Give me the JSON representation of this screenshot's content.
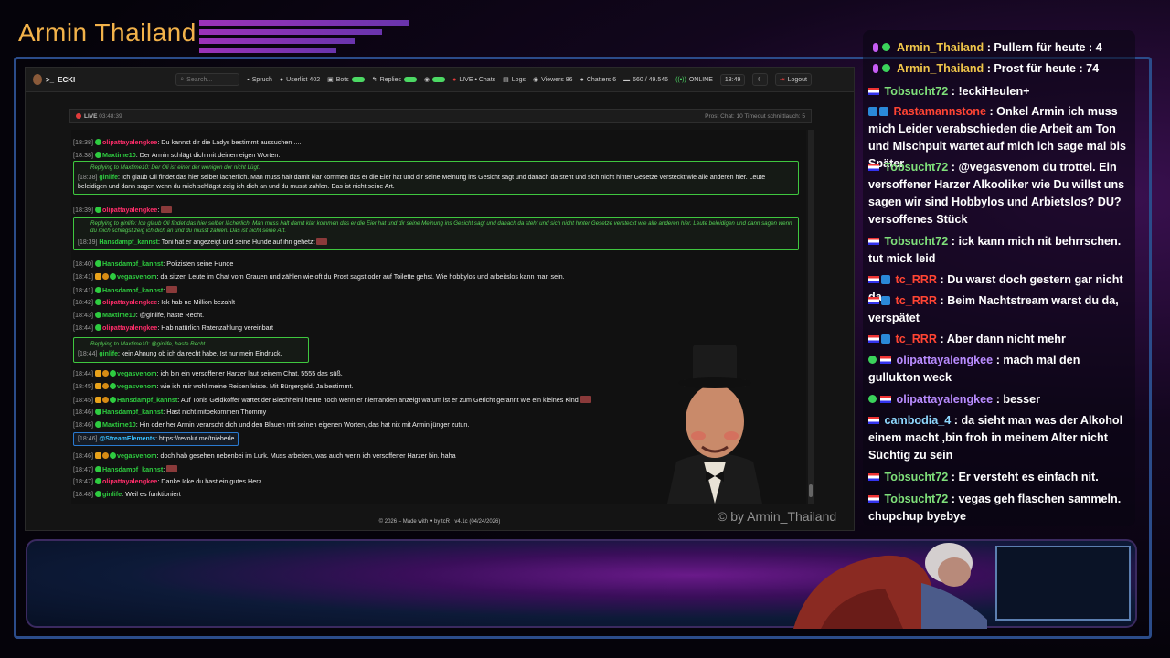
{
  "overlay": {
    "brand_title": "Armin Thailand",
    "watermark": "© by Armin_Thailand"
  },
  "app": {
    "title": "ECKI",
    "search_placeholder": "Search...",
    "toolbar": [
      {
        "icon": "quote-icon",
        "label": "Spruch"
      },
      {
        "icon": "user-icon",
        "label": "Userlist 402"
      },
      {
        "icon": "robot-icon",
        "label": "Bots"
      },
      {
        "icon": "reply-icon",
        "label": "Replies"
      },
      {
        "icon": "eye-icon",
        "label": ""
      },
      {
        "icon": "live-icon",
        "label": "LIVE • Chats"
      },
      {
        "icon": "logs-icon",
        "label": "Logs"
      },
      {
        "icon": "viewers-icon",
        "label": "Viewers 86"
      },
      {
        "icon": "chatters-icon",
        "label": "Chatters 6"
      },
      {
        "icon": "message-icon",
        "label": "660 / 49.546"
      },
      {
        "icon": "online-icon",
        "label": "ONLINE"
      },
      {
        "icon": "clock-icon",
        "label": "18:49"
      },
      {
        "icon": "moon-icon",
        "label": ""
      },
      {
        "icon": "logout-icon",
        "label": "Logout"
      }
    ],
    "live_status": "LIVE",
    "live_time": "03:48:39",
    "live_stats": "Prost Chat: 10   Timeout schnittlauch: 5",
    "footer": "© 2026 – Made with ♥ by tcR · v4.1c (04/24/2026)"
  },
  "chat": [
    {
      "ts": "[18:38]",
      "user": "olipattayalengkee",
      "color": "pink",
      "text": ": Du kannst dir die Ladys bestimmt aussuchen ...."
    },
    {
      "ts": "[18:38]",
      "user": "Maxtime10",
      "color": "green",
      "text": ": Der Armin schlägt dich mit deinen eigen Worten."
    },
    {
      "ts": "[18:39]",
      "user": "olipattayalengkee",
      "color": "pink",
      "text": ":"
    },
    {
      "ts": "[18:40]",
      "user": "Hansdampf_kannst",
      "color": "green",
      "text": ": Polizisten seine Hunde"
    },
    {
      "ts": "[18:41]",
      "user": "vegasvenom",
      "color": "green",
      "text": ": da sitzen Leute im Chat vom Grauen und zählen wie oft du Prost sagst oder auf Toilette gehst. Wie hobbylos und arbeitslos kann man sein."
    },
    {
      "ts": "[18:41]",
      "user": "Hansdampf_kannst",
      "color": "green",
      "text": ":"
    },
    {
      "ts": "[18:42]",
      "user": "olipattayalengkee",
      "color": "pink",
      "text": ": Ick hab ne Million bezahlt"
    },
    {
      "ts": "[18:43]",
      "user": "Maxtime10",
      "color": "green",
      "text": ": @ginlife, haste Recht."
    },
    {
      "ts": "[18:44]",
      "user": "olipattayalengkee",
      "color": "pink",
      "text": ": Hab natürlich Ratenzahlung vereinbart"
    },
    {
      "ts": "[18:44]",
      "user": "vegasvenom",
      "color": "green",
      "text": ": ich bin ein versoffener Harzer laut seinem Chat. 5555 das süß."
    },
    {
      "ts": "[18:45]",
      "user": "vegasvenom",
      "color": "green",
      "text": ": wie ich mir wohl meine Reisen leiste. Mit Bürgergeld. Ja bestimmt."
    },
    {
      "ts": "[18:45]",
      "user": "Hansdampf_kannst",
      "color": "green",
      "text": ": Auf Tonis Geldkoffer wartet der Blechheini heute noch wenn er niemanden anzeigt warum ist er zum Gericht gerannt wie ein kleines Kind"
    },
    {
      "ts": "[18:46]",
      "user": "Hansdampf_kannst",
      "color": "green",
      "text": ": Hast nicht mitbekommen Thommy"
    },
    {
      "ts": "[18:46]",
      "user": "Maxtime10",
      "color": "green",
      "text": ": Hin oder her Armin verarscht dich und den Blauen mit seinen eigenen Worten, das hat nix mit Armin jünger zutun."
    },
    {
      "ts": "[18:46]",
      "user": "vegasvenom",
      "color": "green",
      "text": ": doch hab gesehen nebenbei im Lurk. Muss arbeiten, was auch wenn ich versoffener Harzer bin. haha"
    },
    {
      "ts": "[18:47]",
      "user": "Hansdampf_kannst",
      "color": "green",
      "text": ":"
    },
    {
      "ts": "[18:47]",
      "user": "olipattayalengkee",
      "color": "pink",
      "text": ": Danke Icke du hast ein gutes Herz"
    },
    {
      "ts": "[18:48]",
      "user": "ginlife",
      "color": "green",
      "text": ": Weil es funktioniert"
    }
  ],
  "replies": [
    {
      "reply_to": "Replying to Maxtime10: Der Oli ist einer der wenigen der nicht Lügt.",
      "ts": "[18:38]",
      "user": "ginlife",
      "text": ": Ich glaub Oli findet das hier selber lächerlich. Man muss halt damit klar kommen das er die Eier hat und dir seine Meinung ins Gesicht sagt und danach da steht und sich nicht hinter Gesetze versteckt wie alle anderen hier. Leute beleidigen und dann sagen wenn du mich schlägst zeig ich dich an und du musst zahlen. Das ist nicht seine Art."
    },
    {
      "reply_to": "Replying to ginlife: Ich glaub Oli findet das hier selber lächerlich. Man muss halt damit klar kommen das er die Eier hat und dir seine Meinung ins Gesicht sagt und danach da steht und sich nicht hinter Gesetze versteckt wie alle anderen hier. Leute beleidigen und dann sagen wenn du mich schlägst zeig ich dich an und du musst zahlen. Das ist nicht seine Art.",
      "ts": "[18:39]",
      "user": "Hansdampf_kannst",
      "text": ": Toni hat er angezeigt und seine Hunde auf ihn gehetzt"
    },
    {
      "reply_to": "Replying to Maxtime10: @ginlife, haste Recht.",
      "ts": "[18:44]",
      "user": "ginlife",
      "text": ": kein Ahnung ob ich da recht habe. Ist nur mein Eindruck."
    }
  ],
  "stream_element": {
    "ts": "[18:46]",
    "user": "@StreamElements",
    "text": ": https://revolut.me/tnieberle"
  },
  "side_chat": [
    {
      "user": "Armin_Thailand",
      "text": " : Pullern für heute : 4"
    },
    {
      "user": "Armin_Thailand",
      "text": " : Prost für heute : 74"
    },
    {
      "user": "Tobsucht72",
      "text": " : !eckiHeulen+"
    },
    {
      "user": "Rastamannstone",
      "text": " : Onkel Armin ich muss mich Leider verabschieden die Arbeit am Ton und Mischpult wartet auf mich ich sage mal bis Später"
    },
    {
      "user": "Tobsucht72",
      "text": " : @vegasvenom du trottel. Ein versoffener Harzer Alkooliker wie Du willst uns sagen wir sind Hobbylos und Arbietslos? DU? versoffenes Stück"
    },
    {
      "user": "Tobsucht72",
      "text": " : ick kann mich nit behrrschen. tut mick leid"
    },
    {
      "user": "tc_RRR",
      "text": " : Du warst doch gestern gar nicht da"
    },
    {
      "user": "tc_RRR",
      "text": " : Beim Nachtstream warst du da, verspätet"
    },
    {
      "user": "tc_RRR",
      "text": " : Aber dann nicht mehr"
    },
    {
      "user": "olipattayalengkee",
      "text": " : mach mal den gullukton weck"
    },
    {
      "user": "olipattayalengkee",
      "text": " : besser"
    },
    {
      "user": "cambodia_4",
      "text": " : da sieht man was der Alkohol einem macht ,bin froh in meinem Alter nicht Süchtig zu sein"
    },
    {
      "user": "Tobsucht72",
      "text": " : Er versteht es einfach nit."
    },
    {
      "user": "Tobsucht72",
      "text": " : vegas geh flaschen sammeln. chupchup byebye"
    }
  ]
}
